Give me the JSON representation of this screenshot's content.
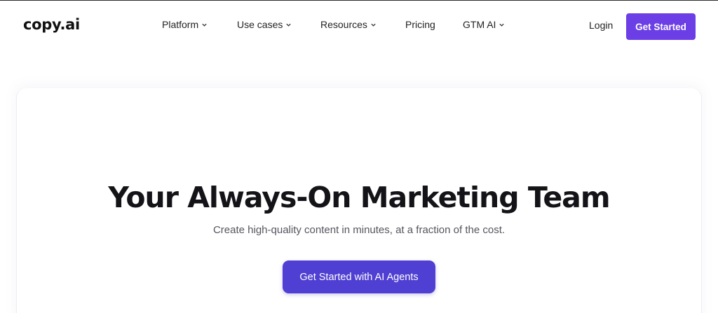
{
  "brand": {
    "logo_text": "copy.ai",
    "accent": "#6b3ee6",
    "cta_color": "#4f3fd2"
  },
  "nav": {
    "items": [
      {
        "label": "Platform",
        "has_dropdown": true,
        "icon": "chevron-down-icon"
      },
      {
        "label": "Use cases",
        "has_dropdown": true,
        "icon": "chevron-down-icon"
      },
      {
        "label": "Resources",
        "has_dropdown": true,
        "icon": "chevron-down-icon"
      },
      {
        "label": "Pricing",
        "has_dropdown": false
      },
      {
        "label": "GTM AI",
        "has_dropdown": true,
        "icon": "chevron-down-icon"
      }
    ],
    "login_label": "Login",
    "get_started_label": "Get Started"
  },
  "hero": {
    "title": "Your Always-On Marketing Team",
    "subtitle": "Create high-quality content in minutes, at a fraction of the cost.",
    "cta_label": "Get Started with AI Agents"
  }
}
